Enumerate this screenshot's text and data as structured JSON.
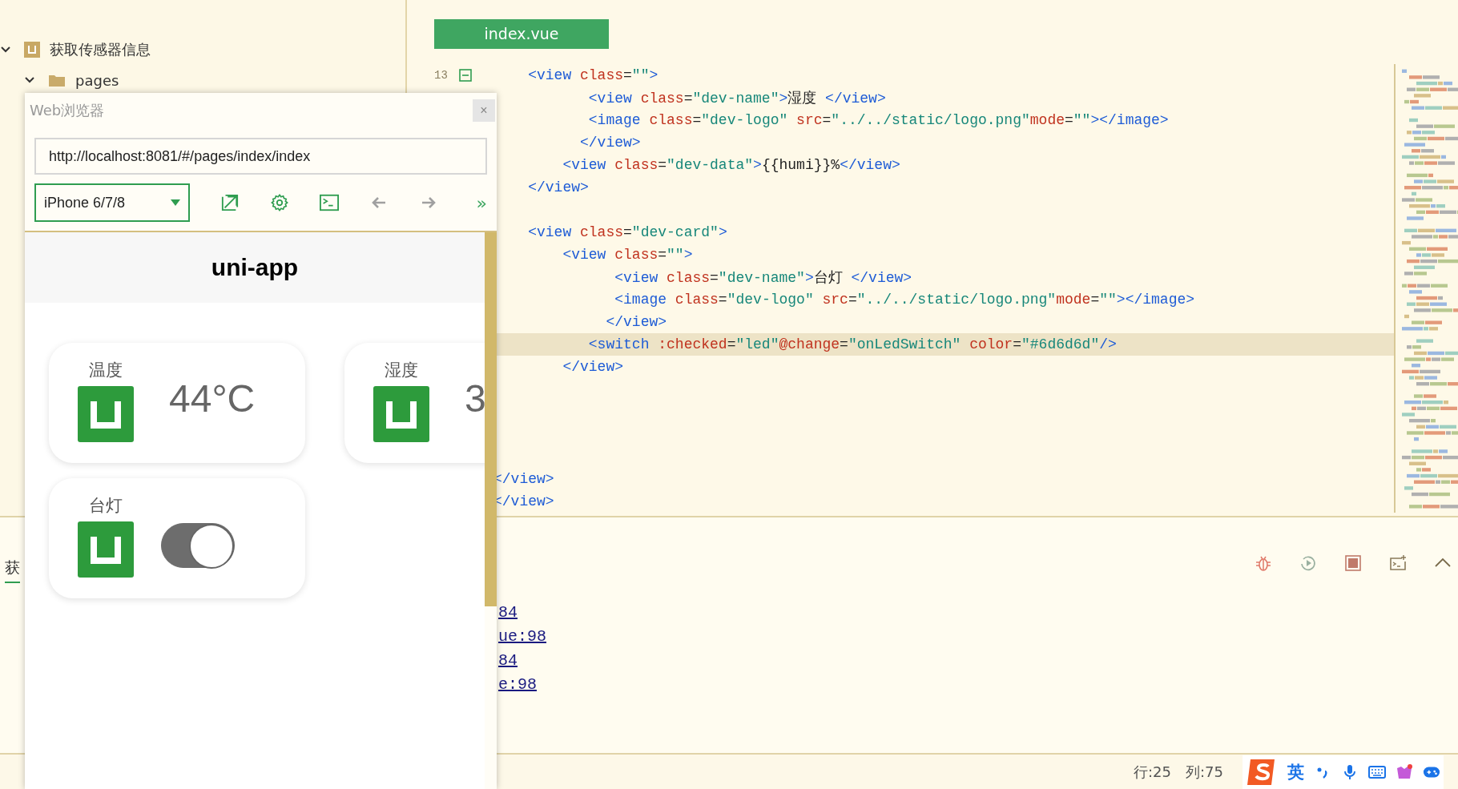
{
  "sidebar": {
    "tree": [
      {
        "label": "获取传感器信息",
        "kind": "project",
        "expanded": true,
        "children": [
          {
            "label": "pages",
            "kind": "folder",
            "expanded": true
          }
        ]
      }
    ]
  },
  "editor": {
    "tab": {
      "label": "index.vue",
      "selected": true
    },
    "lines": [
      {
        "number": "13",
        "current": false,
        "tokens": [
          {
            "kind": "tag",
            "text": "    <view"
          },
          {
            "kind": "attr",
            "text": " class"
          },
          {
            "kind": "text",
            "text": "="
          },
          {
            "kind": "value",
            "text": "\"\""
          },
          {
            "kind": "tag",
            "text": ">"
          }
        ]
      },
      {
        "current": false,
        "tokens": [
          {
            "kind": "tag",
            "text": "           <view"
          },
          {
            "kind": "attr",
            "text": " class"
          },
          {
            "kind": "text",
            "text": "="
          },
          {
            "kind": "value",
            "text": "\"dev-name\""
          },
          {
            "kind": "tag",
            "text": ">"
          },
          {
            "kind": "text",
            "text": "湿度 "
          },
          {
            "kind": "tag",
            "text": "</view>"
          }
        ]
      },
      {
        "current": false,
        "tokens": [
          {
            "kind": "tag",
            "text": "           <image"
          },
          {
            "kind": "attr",
            "text": " class"
          },
          {
            "kind": "text",
            "text": "="
          },
          {
            "kind": "value",
            "text": "\"dev-logo\""
          },
          {
            "kind": "attr",
            "text": " src"
          },
          {
            "kind": "text",
            "text": "="
          },
          {
            "kind": "value",
            "text": "\"../../static/logo.png\""
          },
          {
            "kind": "attr",
            "text": "mode"
          },
          {
            "kind": "text",
            "text": "="
          },
          {
            "kind": "value",
            "text": "\"\""
          },
          {
            "kind": "tag",
            "text": "></image>"
          }
        ]
      },
      {
        "current": false,
        "tokens": [
          {
            "kind": "tag",
            "text": "          </view>"
          }
        ]
      },
      {
        "current": false,
        "tokens": [
          {
            "kind": "tag",
            "text": "        <view"
          },
          {
            "kind": "attr",
            "text": " class"
          },
          {
            "kind": "text",
            "text": "="
          },
          {
            "kind": "value",
            "text": "\"dev-data\""
          },
          {
            "kind": "tag",
            "text": ">"
          },
          {
            "kind": "text",
            "text": "{{humi}}%"
          },
          {
            "kind": "tag",
            "text": "</view>"
          }
        ]
      },
      {
        "current": false,
        "tokens": [
          {
            "kind": "tag",
            "text": "    </view>"
          }
        ]
      },
      {
        "current": false
      },
      {
        "current": false,
        "tokens": [
          {
            "kind": "tag",
            "text": "    <view"
          },
          {
            "kind": "attr",
            "text": " class"
          },
          {
            "kind": "text",
            "text": "="
          },
          {
            "kind": "value",
            "text": "\"dev-card\""
          },
          {
            "kind": "tag",
            "text": ">"
          }
        ]
      },
      {
        "current": false,
        "tokens": [
          {
            "kind": "tag",
            "text": "        <view"
          },
          {
            "kind": "attr",
            "text": " class"
          },
          {
            "kind": "text",
            "text": "="
          },
          {
            "kind": "value",
            "text": "\"\""
          },
          {
            "kind": "tag",
            "text": ">"
          }
        ]
      },
      {
        "current": false,
        "tokens": [
          {
            "kind": "tag",
            "text": "              <view"
          },
          {
            "kind": "attr",
            "text": " class"
          },
          {
            "kind": "text",
            "text": "="
          },
          {
            "kind": "value",
            "text": "\"dev-name\""
          },
          {
            "kind": "tag",
            "text": ">"
          },
          {
            "kind": "text",
            "text": "台灯 "
          },
          {
            "kind": "tag",
            "text": "</view>"
          }
        ]
      },
      {
        "current": false,
        "tokens": [
          {
            "kind": "tag",
            "text": "              <image"
          },
          {
            "kind": "attr",
            "text": " class"
          },
          {
            "kind": "text",
            "text": "="
          },
          {
            "kind": "value",
            "text": "\"dev-logo\""
          },
          {
            "kind": "attr",
            "text": " src"
          },
          {
            "kind": "text",
            "text": "="
          },
          {
            "kind": "value",
            "text": "\"../../static/logo.png\""
          },
          {
            "kind": "attr",
            "text": "mode"
          },
          {
            "kind": "text",
            "text": "="
          },
          {
            "kind": "value",
            "text": "\"\""
          },
          {
            "kind": "tag",
            "text": "></image>"
          }
        ]
      },
      {
        "current": false,
        "tokens": [
          {
            "kind": "tag",
            "text": "             </view>"
          }
        ]
      },
      {
        "current": true,
        "tokens": [
          {
            "kind": "tag",
            "text": "           <switch"
          },
          {
            "kind": "attr",
            "text": " :checked"
          },
          {
            "kind": "text",
            "text": "="
          },
          {
            "kind": "value",
            "text": "\"led\""
          },
          {
            "kind": "attr",
            "text": "@change"
          },
          {
            "kind": "text",
            "text": "="
          },
          {
            "kind": "value",
            "text": "\"onLedSwitch\""
          },
          {
            "kind": "attr",
            "text": " color"
          },
          {
            "kind": "text",
            "text": "="
          },
          {
            "kind": "value",
            "text": "\"#6d6d6d\""
          },
          {
            "kind": "tag",
            "text": "/>"
          }
        ]
      },
      {
        "current": false,
        "tokens": [
          {
            "kind": "tag",
            "text": "        </view>"
          }
        ]
      },
      {
        "current": false
      },
      {
        "current": false
      },
      {
        "current": false
      },
      {
        "current": false
      },
      {
        "current": false,
        "tokens": [
          {
            "kind": "tag",
            "text": "</view>"
          }
        ]
      },
      {
        "current": false,
        "tokens": [
          {
            "kind": "tag",
            "text": "</view>"
          }
        ]
      }
    ]
  },
  "browser": {
    "title": "Web浏览器",
    "close": "×",
    "url": "http://localhost:8081/#/pages/index/index",
    "device": "iPhone 6/7/8",
    "more": "»",
    "nav_buttons": [
      {
        "kind": "back",
        "disabled": true
      },
      {
        "kind": "forward",
        "disabled": true
      }
    ],
    "page": {
      "nav_title": "uni-app",
      "cards": [
        {
          "kind": "reading",
          "label": "温度",
          "value": "44°C"
        },
        {
          "kind": "reading",
          "label": "湿度",
          "value": "3"
        },
        {
          "kind": "switch",
          "label": "台灯",
          "checked": true
        }
      ]
    }
  },
  "console": {
    "tab": "获",
    "links": [
      "84",
      "ue:98",
      "84",
      "e:98"
    ]
  },
  "status_bar": {
    "line": "行:25",
    "column": "列:75",
    "ime_mode": "英"
  }
}
